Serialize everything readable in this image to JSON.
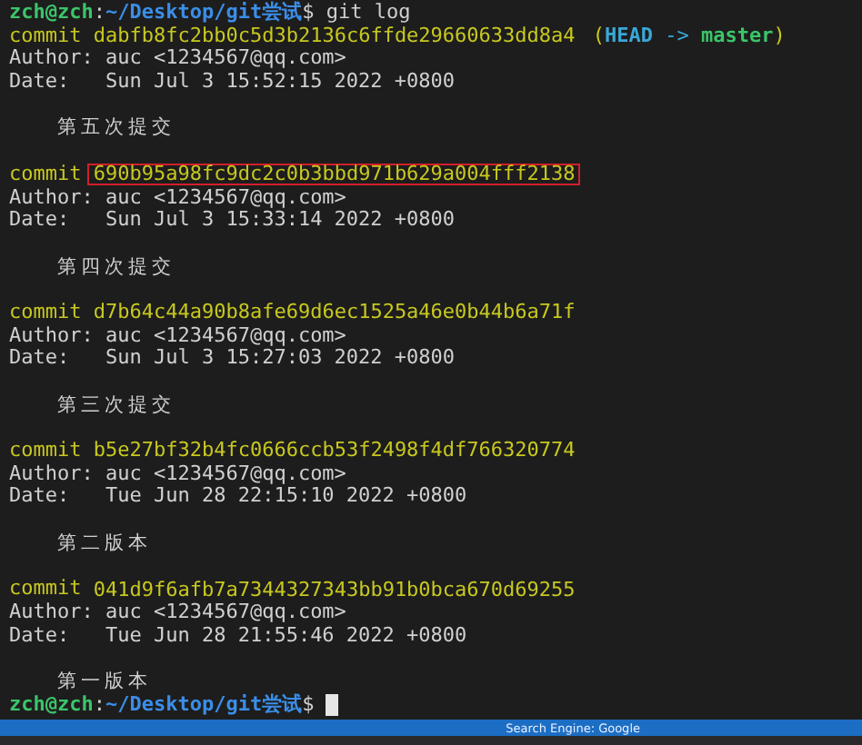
{
  "prompt": {
    "user": "zch@zch",
    "separator": ":",
    "path": "~/Desktop/git尝试",
    "symbol": "$",
    "command": "git log"
  },
  "commits": [
    {
      "label": "commit",
      "hash": "dabfb8fc2bb0c5d3b2136c6ffde29660633dd8a4",
      "refs": {
        "open": "(",
        "close": ")",
        "head": "HEAD",
        "arrow": "->",
        "branch": "master"
      },
      "highlighted": false,
      "author": "Author: auc <1234567@qq.com>",
      "date": "Date:   Sun Jul 3 15:52:15 2022 +0800",
      "message": "第五次提交"
    },
    {
      "label": "commit",
      "hash": "690b95a98fc9dc2c0b3bbd971b629a004fff2138",
      "highlighted": true,
      "author": "Author: auc <1234567@qq.com>",
      "date": "Date:   Sun Jul 3 15:33:14 2022 +0800",
      "message": "第四次提交"
    },
    {
      "label": "commit",
      "hash": "d7b64c44a90b8afe69d6ec1525a46e0b44b6a71f",
      "highlighted": false,
      "author": "Author: auc <1234567@qq.com>",
      "date": "Date:   Sun Jul 3 15:27:03 2022 +0800",
      "message": "第三次提交"
    },
    {
      "label": "commit",
      "hash": "b5e27bf32b4fc0666ccb53f2498f4df766320774",
      "highlighted": false,
      "author": "Author: auc <1234567@qq.com>",
      "date": "Date:   Tue Jun 28 22:15:10 2022 +0800",
      "message": "第二版本"
    },
    {
      "label": "commit",
      "hash": "041d9f6afb7a7344327343bb91b0bca670d69255",
      "highlighted": false,
      "author": "Author: auc <1234567@qq.com>",
      "date": "Date:   Tue Jun 28 21:55:46 2022 +0800",
      "message": "第一版本"
    }
  ],
  "final_prompt": {
    "user": "zch@zch",
    "separator": ":",
    "path": "~/Desktop/git尝试",
    "symbol": "$",
    "cursor_visible": true
  },
  "status_bar": {
    "search_engine": "Search Engine: Google"
  }
}
